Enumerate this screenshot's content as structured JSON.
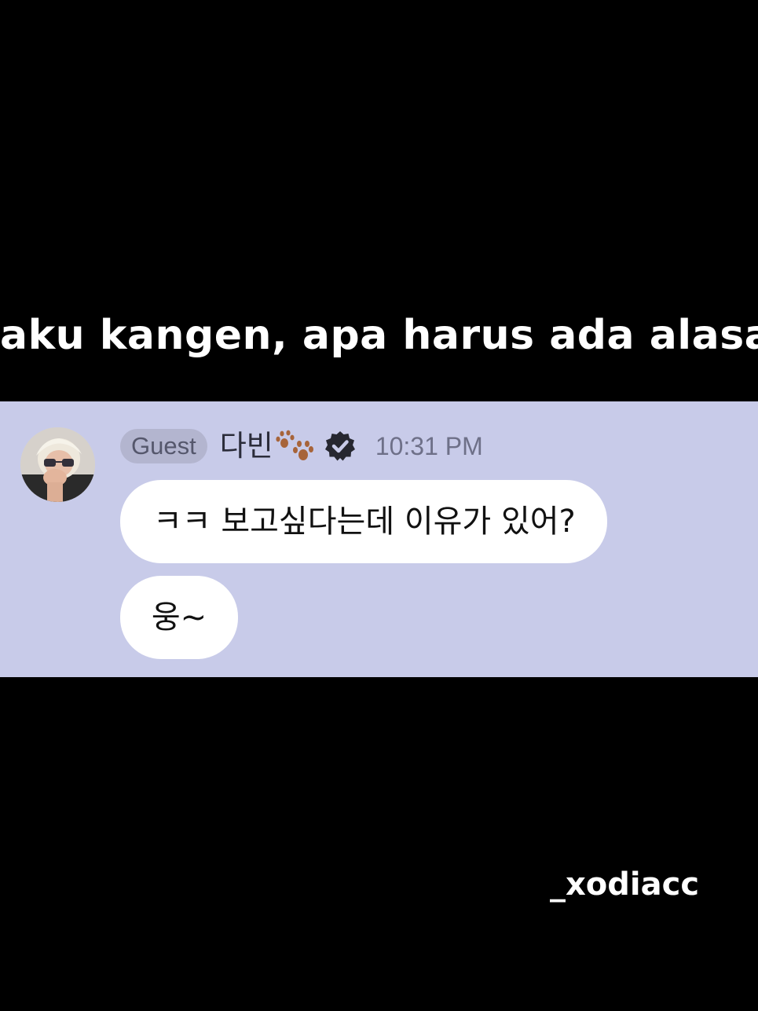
{
  "caption": {
    "text": "aku kangen, apa harus ada alasa"
  },
  "chat": {
    "panel_color": "#c8cbe9",
    "message": {
      "badge": "Guest",
      "username": "다빈",
      "username_icon": "paw-print-icon",
      "verified_icon": "verified-check-icon",
      "timestamp": "10:31 PM",
      "bubbles": [
        "ㅋㅋ 보고싶다는데 이유가 있어?",
        "웅~"
      ]
    }
  },
  "watermark": {
    "text": "_xodiacc"
  }
}
